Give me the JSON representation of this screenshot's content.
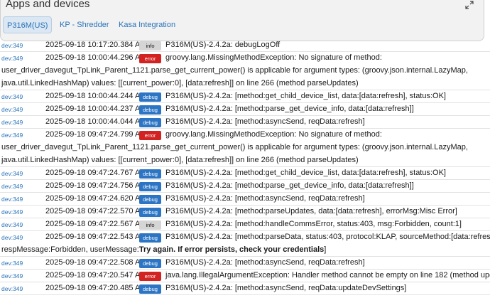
{
  "header": {
    "title": "Apps and devices",
    "tabs": [
      {
        "label": "P316M(US)"
      },
      {
        "label": "KP - Shredder"
      },
      {
        "label": "Kasa Integration"
      }
    ]
  },
  "log": [
    {
      "dev": "dev:349",
      "ts": "2025-09-18 10:17:20.384 AM",
      "level": "info",
      "msg": "P316M(US)-2.4.2a: debugLogOff"
    },
    {
      "dev": "dev:349",
      "ts": "2025-09-18 10:00:44.296 AM",
      "level": "error",
      "msg": "groovy.lang.MissingMethodException: No signature of method:",
      "cont1": "user_driver_davegut_TpLink_Parent_1121.parse_get_current_power() is applicable for argument types: (groovy.json.internal.LazyMap,",
      "cont2": "java.util.LinkedHashMap) values: [[current_power:0], [data:refresh]] on line 266 (method parseUpdates)"
    },
    {
      "dev": "dev:349",
      "ts": "2025-09-18 10:00:44.244 AM",
      "level": "debug",
      "msg": "P316M(US)-2.4.2a: [method:get_child_device_list, data:[data:refresh], status:OK]"
    },
    {
      "dev": "dev:349",
      "ts": "2025-09-18 10:00:44.237 AM",
      "level": "debug",
      "msg": "P316M(US)-2.4.2a: [method:parse_get_device_info, data:[data:refresh]]"
    },
    {
      "dev": "dev:349",
      "ts": "2025-09-18 10:00:44.044 AM",
      "level": "debug",
      "msg": "P316M(US)-2.4.2a: [method:asyncSend, reqData:refresh]"
    },
    {
      "dev": "dev:349",
      "ts": "2025-09-18 09:47:24.799 AM",
      "level": "error",
      "msg": "groovy.lang.MissingMethodException: No signature of method:",
      "cont1": "user_driver_davegut_TpLink_Parent_1121.parse_get_current_power() is applicable for argument types: (groovy.json.internal.LazyMap,",
      "cont2": "java.util.LinkedHashMap) values: [[current_power:0], [data:refresh]] on line 266 (method parseUpdates)"
    },
    {
      "dev": "dev:349",
      "ts": "2025-09-18 09:47:24.767 AM",
      "level": "debug",
      "msg": "P316M(US)-2.4.2a: [method:get_child_device_list, data:[data:refresh], status:OK]"
    },
    {
      "dev": "dev:349",
      "ts": "2025-09-18 09:47:24.756 AM",
      "level": "debug",
      "msg": "P316M(US)-2.4.2a: [method:parse_get_device_info, data:[data:refresh]]"
    },
    {
      "dev": "dev:349",
      "ts": "2025-09-18 09:47:24.620 AM",
      "level": "debug",
      "msg": "P316M(US)-2.4.2a: [method:asyncSend, reqData:refresh]"
    },
    {
      "dev": "dev:349",
      "ts": "2025-09-18 09:47:22.570 AM",
      "level": "debug",
      "msg": "P316M(US)-2.4.2a: [method:parseUpdates, data:[data:refresh], errorMsg:Misc Error]"
    },
    {
      "dev": "dev:349",
      "ts": "2025-09-18 09:47:22.567 AM",
      "level": "info",
      "msg": "P316M(US)-2.4.2a: [method:handleCommsError, status:403, msg:Forbidden, count:1]"
    },
    {
      "dev": "dev:349",
      "ts": "2025-09-18 09:47:22.543 AM",
      "level": "debug",
      "msg": "P316M(US)-2.4.2a: [method:parseData, status:403, protocol:KLAP, sourceMethod:[data:refresh],",
      "cont1": "respMessage:Forbidden, userMessage:",
      "cont1_strong": "Try again. If error persists, check your credentials",
      "cont1_end": "]"
    },
    {
      "dev": "dev:349",
      "ts": "2025-09-18 09:47:22.508 AM",
      "level": "debug",
      "msg": "P316M(US)-2.4.2a: [method:asyncSend, reqData:refresh]"
    },
    {
      "dev": "dev:349",
      "ts": "2025-09-18 09:47:20.547 AM",
      "level": "error",
      "msg": "java.lang.IllegalArgumentException: Handler method cannot be empty on line 182 (method updated)"
    },
    {
      "dev": "dev:349",
      "ts": "2025-09-18 09:47:20.485 AM",
      "level": "debug",
      "msg": "P316M(US)-2.4.2a: [method:asyncSend, reqData:updateDevSettings]"
    }
  ],
  "icons": {
    "expand": "expand-icon"
  },
  "colors": {
    "error": "#d32222",
    "debug": "#2b75c4",
    "info": "#d5d5d5",
    "link": "#2a73b8"
  }
}
